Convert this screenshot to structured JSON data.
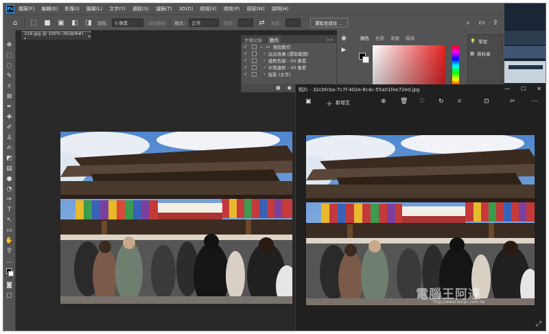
{
  "app": {
    "logo": "Ps"
  },
  "menubar": {
    "items": [
      "檔案(F)",
      "編輯(E)",
      "影像(I)",
      "圖層(L)",
      "文字(Y)",
      "選取(S)",
      "濾鏡(T)",
      "3D(D)",
      "檢視(V)",
      "增效(P)",
      "視窗(W)",
      "說明(H)"
    ]
  },
  "options": {
    "feather_label": "羽化:",
    "feather_value": "0 像素",
    "antialias": "消除鋸齒",
    "style_label": "樣式:",
    "style_value": "正常",
    "width_label": "寬度:",
    "height_label": "高度:",
    "select_mask": "選取並遮住 ..."
  },
  "document": {
    "tab": "319.jpg @ 100% (RGB/8#) *",
    "close": "×"
  },
  "actions_panel": {
    "tabs": [
      "步驟記錄",
      "動作"
    ],
    "expand": ">>",
    "set_name": "預設動作",
    "items": [
      "淡出效果 (選取範圍)",
      "邊框色頭 - 50 像素",
      "木質邊框 - 50 像素",
      "陰影 (文字)"
    ]
  },
  "color_panel": {
    "tabs": [
      "顏色",
      "色票",
      "漸層",
      "圖樣"
    ]
  },
  "learn_panel": {
    "items": [
      "學習",
      "資料庫"
    ]
  },
  "photos_app": {
    "title": "相片 - 32cbfcba-7c7f-402e-8c4c-55a01fee72ed.jpg",
    "new_edit": "新增至",
    "window_buttons": [
      "—",
      "☐",
      "✕"
    ]
  },
  "watermark": {
    "text": "電腦王阿達",
    "url": "http://www.kocpc.com.tw"
  },
  "colors": {
    "ps_panel": "#535353",
    "ps_dark": "#282828",
    "photos_bg": "#202020",
    "accent": "#31a8ff"
  }
}
